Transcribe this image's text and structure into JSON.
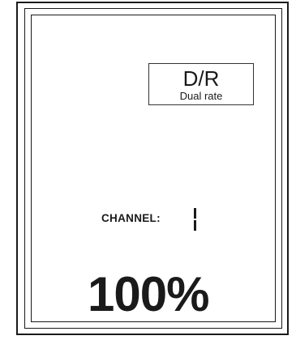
{
  "display": {
    "mode": {
      "code": "D/R",
      "name": "Dual rate"
    },
    "channel": {
      "label": "CHANNEL:",
      "value": "1"
    },
    "rate": {
      "value_text": "100%",
      "percent": 100
    }
  }
}
